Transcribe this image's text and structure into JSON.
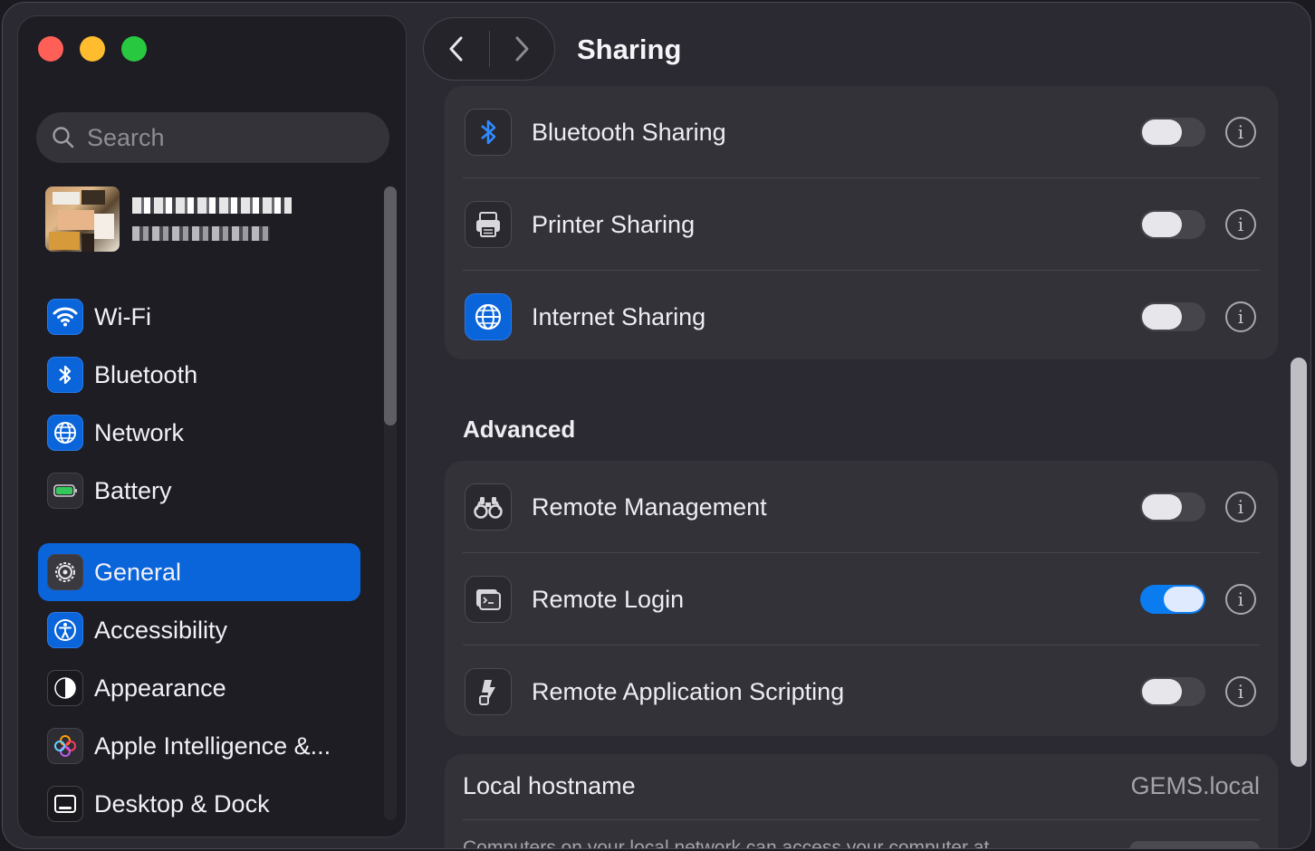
{
  "window": {
    "title": "Sharing"
  },
  "sidebar": {
    "search_placeholder": "Search",
    "items": [
      {
        "label": "Wi-Fi",
        "icon": "wifi-icon",
        "active": false
      },
      {
        "label": "Bluetooth",
        "icon": "bluetooth-icon",
        "active": false
      },
      {
        "label": "Network",
        "icon": "globe-icon",
        "active": false
      },
      {
        "label": "Battery",
        "icon": "battery-icon",
        "active": false
      },
      {
        "label": "General",
        "icon": "gear-icon",
        "active": true
      },
      {
        "label": "Accessibility",
        "icon": "accessibility-icon",
        "active": false
      },
      {
        "label": "Appearance",
        "icon": "appearance-icon",
        "active": false
      },
      {
        "label": "Apple Intelligence &...",
        "icon": "apple-intelligence-icon",
        "active": false
      },
      {
        "label": "Desktop & Dock",
        "icon": "desktop-dock-icon",
        "active": false
      }
    ]
  },
  "content": {
    "top_rows": [
      {
        "label": "Bluetooth Sharing",
        "icon": "bluetooth-sharing-icon",
        "enabled": false
      },
      {
        "label": "Printer Sharing",
        "icon": "printer-icon",
        "enabled": false
      },
      {
        "label": "Internet Sharing",
        "icon": "globe-icon",
        "enabled": false
      }
    ],
    "advanced": {
      "title": "Advanced",
      "rows": [
        {
          "label": "Remote Management",
          "icon": "binoculars-icon",
          "enabled": false
        },
        {
          "label": "Remote Login",
          "icon": "terminal-icon",
          "enabled": true
        },
        {
          "label": "Remote Application Scripting",
          "icon": "script-icon",
          "enabled": false
        }
      ]
    },
    "hostname": {
      "label": "Local hostname",
      "value": "GEMS.local",
      "description": "Computers on your local network can access your computer at"
    }
  },
  "colors": {
    "accent": "#0a64da",
    "toggle_on": "#0a7cf0"
  }
}
